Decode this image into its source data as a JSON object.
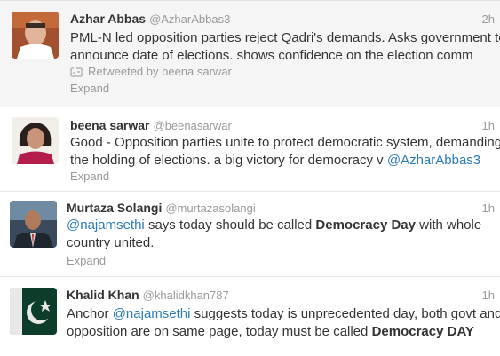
{
  "tweets": [
    {
      "name": "Azhar Abbas",
      "handle": "@AzharAbbas3",
      "time": "2h",
      "line1": "PML-N led opposition parties reject Qadri's demands. Asks government to",
      "line2": "announce date of elections. shows confidence on the election comm",
      "retweeted_by": "Retweeted by beena sarwar",
      "expand": "Expand"
    },
    {
      "name": "beena sarwar",
      "handle": "@beenasarwar",
      "time": "1h",
      "line1": "Good - Opposition parties unite to protect democratic system, demanding",
      "line2_prefix": "the holding of elections. a big victory for democracy v ",
      "line2_mention": "@AzharAbbas3",
      "expand": "Expand"
    },
    {
      "name": "Murtaza Solangi",
      "handle": "@murtazasolangi",
      "time": "1h",
      "line1_mention": "@najamsethi",
      "line1_mid": " says today should be called ",
      "line1_bold": "Democracy Day",
      "line1_end": " with whole",
      "line2": "country united.",
      "expand": "Expand"
    },
    {
      "name": "Khalid Khan",
      "handle": "@khalidkhan787",
      "time": "1h",
      "line1_start": "Anchor ",
      "line1_mention": "@najamsethi",
      "line1_end": " suggests today is unprecedented day, both govt and",
      "line2_start": "opposition are on same page, today must be called ",
      "line2_bold": "Democracy DAY"
    }
  ],
  "colors": {
    "link": "#2b7bb9",
    "muted": "#999999",
    "text": "#333333",
    "highlight_bg": "#f5f5f5"
  },
  "icons": {
    "retweet": "retweet-icon"
  }
}
